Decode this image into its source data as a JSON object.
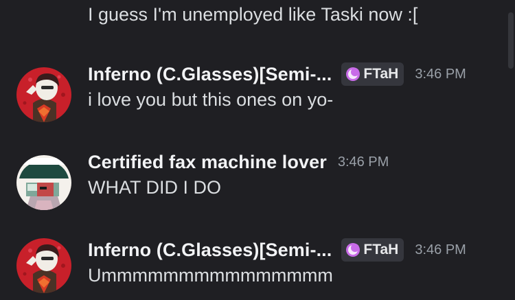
{
  "top_message": {
    "text": "I guess I'm unemployed like Taski now :["
  },
  "messages": [
    {
      "username": "Inferno (C.Glasses)[Semi-...",
      "tag": "FTaH",
      "time": "3:46 PM",
      "content": "i love you but this ones on yo-",
      "avatar": "inferno-avatar"
    },
    {
      "username": "Certified fax machine lover",
      "time": "3:46 PM",
      "content": "WHAT DID I DO",
      "avatar": "fax-lover-avatar"
    },
    {
      "username": "Inferno (C.Glasses)[Semi-...",
      "tag": "FTaH",
      "time": "3:46 PM",
      "content": "Ummmmmmmmmmmmmmm",
      "avatar": "inferno-avatar"
    }
  ],
  "colors": {
    "background": "#1f1f23",
    "username": "#f2f3f5",
    "text": "#dbdee1",
    "timestamp": "#9aa0a8",
    "tag_bg": "#35363d",
    "tag_icon": "#c86be8"
  }
}
